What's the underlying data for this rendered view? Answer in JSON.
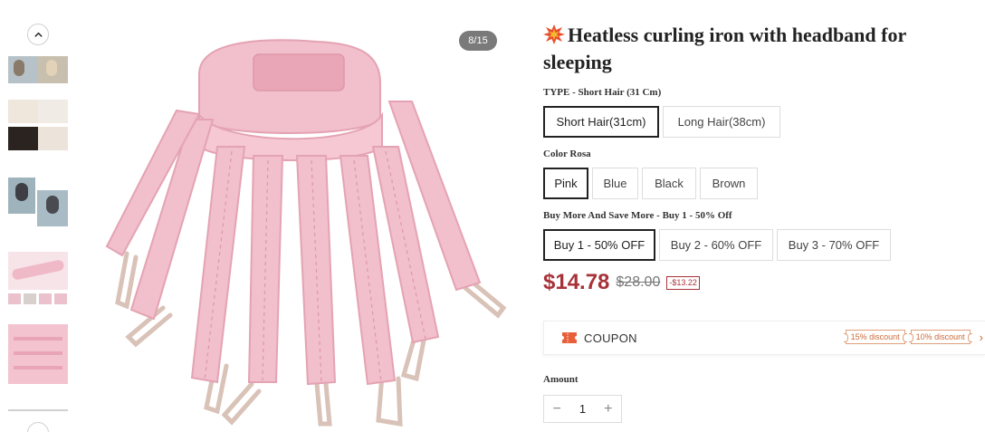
{
  "gallery": {
    "counter": "8/15",
    "colors": {
      "pink": "#f2bfcc",
      "pink_dark": "#e4a3b3",
      "strap": "#d9c2b7",
      "bg": "#ffffff"
    }
  },
  "product": {
    "title": "Heatless curling iron with headband for sleeping",
    "title_icon": "collision-burst-icon"
  },
  "options": {
    "type": {
      "label": "TYPE - Short Hair (31 Cm)",
      "values": [
        "Short Hair(31cm)",
        "Long Hair(38cm)"
      ],
      "selected": 0
    },
    "color": {
      "label": "Color Rosa",
      "values": [
        "Pink",
        "Blue",
        "Black",
        "Brown"
      ],
      "selected": 0
    },
    "bundle": {
      "label": "Buy More And Save More - Buy 1 - 50% Off",
      "values": [
        "Buy 1 - 50% OFF",
        "Buy 2 - 60% OFF",
        "Buy 3 - 70% OFF"
      ],
      "selected": 0
    }
  },
  "pricing": {
    "price": "$14.78",
    "compare_at": "$28.00",
    "savings": "-$13.22",
    "accent": "#a8323a"
  },
  "coupon": {
    "label": "COUPON",
    "tickets": [
      "15% discount",
      "10% discount"
    ],
    "accent": "#c96a3a"
  },
  "quantity": {
    "label": "Amount",
    "value": "1",
    "minus": "−",
    "plus": "+"
  }
}
